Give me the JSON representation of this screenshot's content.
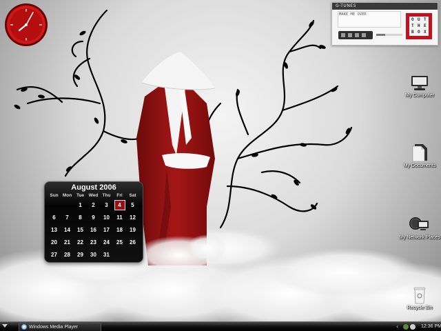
{
  "colors": {
    "accent_red": "#9c0f10",
    "robe_red": "#8f1010",
    "taskbar": "#0d0d0d"
  },
  "gtunes": {
    "title": "G-TUNES",
    "song": "MAKE ME OVER",
    "artist": "",
    "time": "",
    "album_letters": [
      "O",
      "U",
      "T",
      "T",
      "H",
      "E",
      "B",
      "O",
      "X"
    ],
    "progress": 0.35
  },
  "desktop_icons": [
    {
      "label": "My Computer",
      "icon": "computer-icon"
    },
    {
      "label": "My Documents",
      "icon": "documents-icon"
    },
    {
      "label": "My Network Places",
      "icon": "network-icon"
    },
    {
      "label": "Recycle Bin",
      "icon": "recycle-bin-icon"
    }
  ],
  "calendar": {
    "month_year": "August 2006",
    "weekdays": [
      "Sun",
      "Mon",
      "Tue",
      "Wed",
      "Thu",
      "Fri",
      "Sat"
    ],
    "weeks": [
      [
        "",
        "",
        "1",
        "2",
        "3",
        "4",
        "5"
      ],
      [
        "6",
        "7",
        "8",
        "9",
        "10",
        "11",
        "12"
      ],
      [
        "13",
        "14",
        "15",
        "16",
        "17",
        "18",
        "19"
      ],
      [
        "20",
        "21",
        "22",
        "23",
        "24",
        "25",
        "26"
      ],
      [
        "27",
        "28",
        "29",
        "30",
        "31",
        "",
        ""
      ]
    ],
    "today": "4"
  },
  "taskbar": {
    "window_title": "Windows Media Player",
    "clock": "12:36 PM"
  }
}
